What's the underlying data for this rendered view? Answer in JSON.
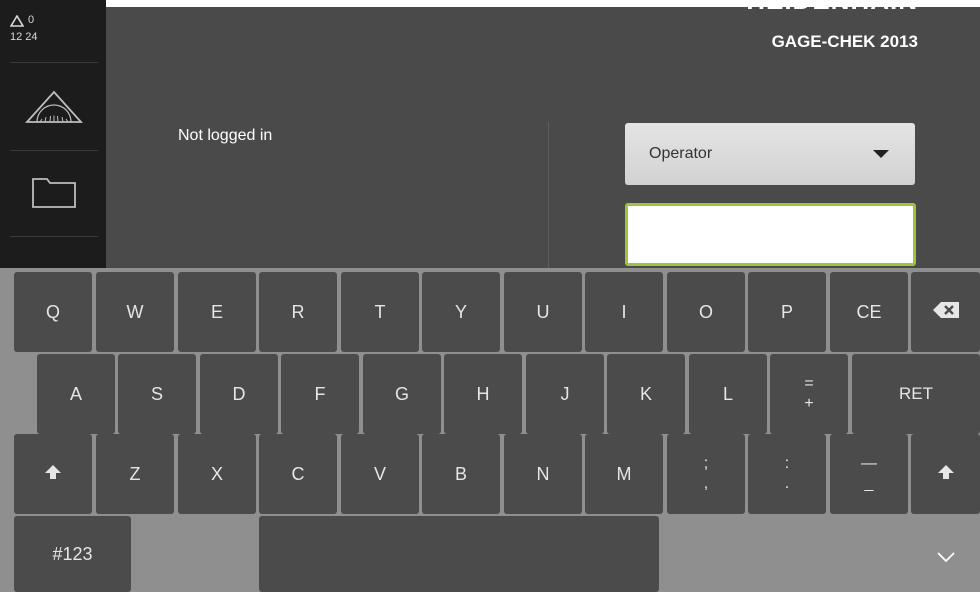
{
  "sidebar": {
    "warning_count": "0",
    "time": "12 24",
    "items": [
      {
        "name": "measure",
        "icon": "protractor-triangle-icon"
      },
      {
        "name": "files",
        "icon": "folder-icon"
      }
    ]
  },
  "header": {
    "product": "GAGE-CHEK 2013"
  },
  "login": {
    "status": "Not logged in",
    "user": "Operator",
    "password_value": ""
  },
  "keyboard": {
    "row1": [
      "Q",
      "W",
      "E",
      "R",
      "T",
      "Y",
      "U",
      "I",
      "O",
      "P",
      "CE"
    ],
    "row2": [
      "A",
      "S",
      "D",
      "F",
      "G",
      "H",
      "J",
      "K",
      "L"
    ],
    "row2_dual": {
      "top": "=",
      "bottom": "+"
    },
    "row2_enter": "RET",
    "row3": [
      "Z",
      "X",
      "C",
      "V",
      "B",
      "N",
      "M"
    ],
    "row3_dual": [
      {
        "top": ";",
        "bottom": ","
      },
      {
        "top": ":",
        "bottom": "."
      },
      {
        "top": "—",
        "bottom": "_"
      }
    ],
    "mode_key": "#123",
    "icons": {
      "backspace": "backspace-icon",
      "shift": "shift-arrow-icon",
      "hide": "chevron-down-icon"
    }
  },
  "colors": {
    "sidebar_bg": "#1c1c1c",
    "main_bg": "#4a4a4a",
    "keyboard_bg": "#8f8f8f",
    "key_bg": "#4b4b4b",
    "focus_border": "#9dc43c"
  }
}
